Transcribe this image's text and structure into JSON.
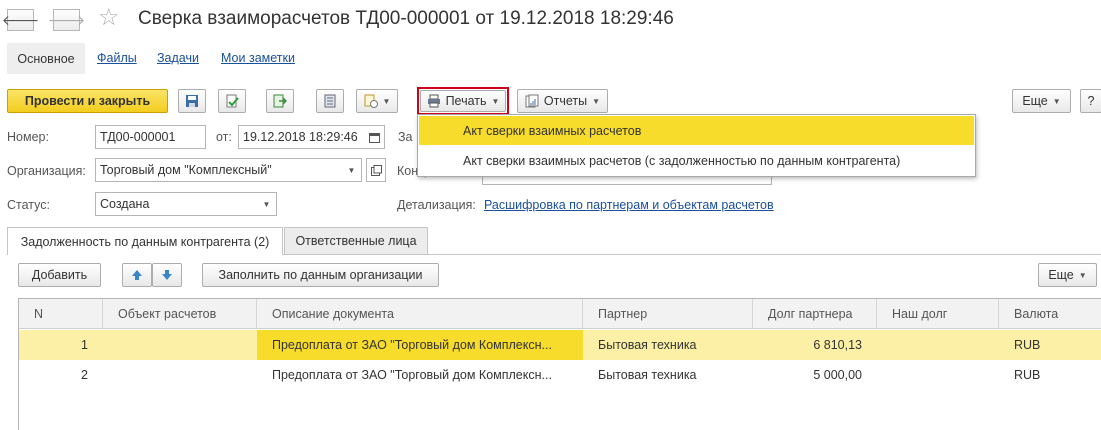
{
  "window": {
    "title": "Сверка взаиморасчетов ТД00-000001 от 19.12.2018 18:29:46",
    "back_icon": "arrow-left",
    "forward_icon": "arrow-right",
    "favorite_icon": "star-outline"
  },
  "nav_tabs": [
    {
      "label": "Основное"
    },
    {
      "label": "Файлы"
    },
    {
      "label": "Задачи"
    },
    {
      "label": "Мои заметки"
    }
  ],
  "toolbar": {
    "post_close_label": "Провести и закрыть",
    "print_label": "Печать",
    "reports_label": "Отчеты",
    "more_label": "Еще",
    "help_label": "?",
    "accent_color": "#f3cd1e",
    "print_highlight_color": "#d0021b"
  },
  "print_menu": {
    "items": [
      {
        "label": "Акт сверки взаимных расчетов"
      },
      {
        "label": "Акт сверки взаимных расчетов (с задолженностью по данным контрагента)"
      }
    ]
  },
  "form": {
    "number_label": "Номер:",
    "number_value": "ТД00-000001",
    "date_label": "от:",
    "date_value": "19.12.2018 18:29:46",
    "org_label": "Организация:",
    "org_value": "Торговый дом \"Комплексный\"",
    "status_label": "Статус:",
    "status_value": "Создана",
    "period_label_part": "За",
    "counterparty_label_part": "Контр",
    "detail_label": "Детализация:",
    "detail_link": "Расшифровка по партнерам и объектам расчетов"
  },
  "page_tabs": [
    {
      "label": "Задолженность по данным контрагента (2)"
    },
    {
      "label": "Ответственные лица"
    }
  ],
  "table_toolbar": {
    "add_label": "Добавить",
    "fill_label": "Заполнить по данным организации",
    "more_label": "Еще"
  },
  "table": {
    "columns": [
      "N",
      "Объект расчетов",
      "Описание документа",
      "Партнер",
      "Долг партнера",
      "Наш долг",
      "Валюта"
    ],
    "rows": [
      {
        "n": "1",
        "object": "",
        "description": "Предоплата от ЗАО \"Торговый дом Комплексн...",
        "partner": "Бытовая техника",
        "partner_debt": "6 810,13",
        "our_debt": "",
        "currency": "RUB"
      },
      {
        "n": "2",
        "object": "",
        "description": "Предоплата от ЗАО \"Торговый дом Комплексн...",
        "partner": "Бытовая техника",
        "partner_debt": "5 000,00",
        "our_debt": "",
        "currency": "RUB"
      }
    ],
    "selected_row_color": "#fbf0a5"
  }
}
